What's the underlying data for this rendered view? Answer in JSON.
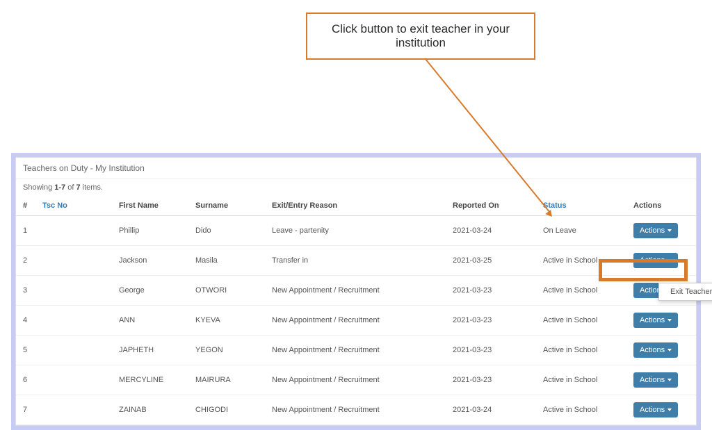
{
  "callout": {
    "text": "Click button to exit teacher in your institution"
  },
  "panel": {
    "title": "Teachers on Duty - My Institution",
    "summary_prefix": "Showing ",
    "summary_range": "1-7",
    "summary_mid": " of ",
    "summary_total": "7",
    "summary_suffix": " items."
  },
  "columns": {
    "num": "#",
    "tsc": "Tsc No",
    "first_name": "First Name",
    "surname": "Surname",
    "reason": "Exit/Entry Reason",
    "reported": "Reported On",
    "status": "Status",
    "actions": "Actions"
  },
  "action_button_label": "Actions",
  "dropdown": {
    "exit_teacher": "Exit Teacher"
  },
  "rows": [
    {
      "num": "1",
      "first_name": "Phillip",
      "surname": "Dido",
      "reason": "Leave - partenity",
      "reported": "2021-03-24",
      "status": "On Leave"
    },
    {
      "num": "2",
      "first_name": "Jackson",
      "surname": "Masila",
      "reason": "Transfer in",
      "reported": "2021-03-25",
      "status": "Active in School"
    },
    {
      "num": "3",
      "first_name": "George",
      "surname": "OTWORI",
      "reason": "New Appointment / Recruitment",
      "reported": "2021-03-23",
      "status": "Active in School"
    },
    {
      "num": "4",
      "first_name": "ANN",
      "surname": "KYEVA",
      "reason": "New Appointment / Recruitment",
      "reported": "2021-03-23",
      "status": "Active in School"
    },
    {
      "num": "5",
      "first_name": "JAPHETH",
      "surname": "YEGON",
      "reason": "New Appointment / Recruitment",
      "reported": "2021-03-23",
      "status": "Active in School"
    },
    {
      "num": "6",
      "first_name": "MERCYLINE",
      "surname": "MAIRURA",
      "reason": "New Appointment / Recruitment",
      "reported": "2021-03-23",
      "status": "Active in School"
    },
    {
      "num": "7",
      "first_name": "ZAINAB",
      "surname": "CHIGODI",
      "reason": "New Appointment / Recruitment",
      "reported": "2021-03-24",
      "status": "Active in School"
    }
  ]
}
